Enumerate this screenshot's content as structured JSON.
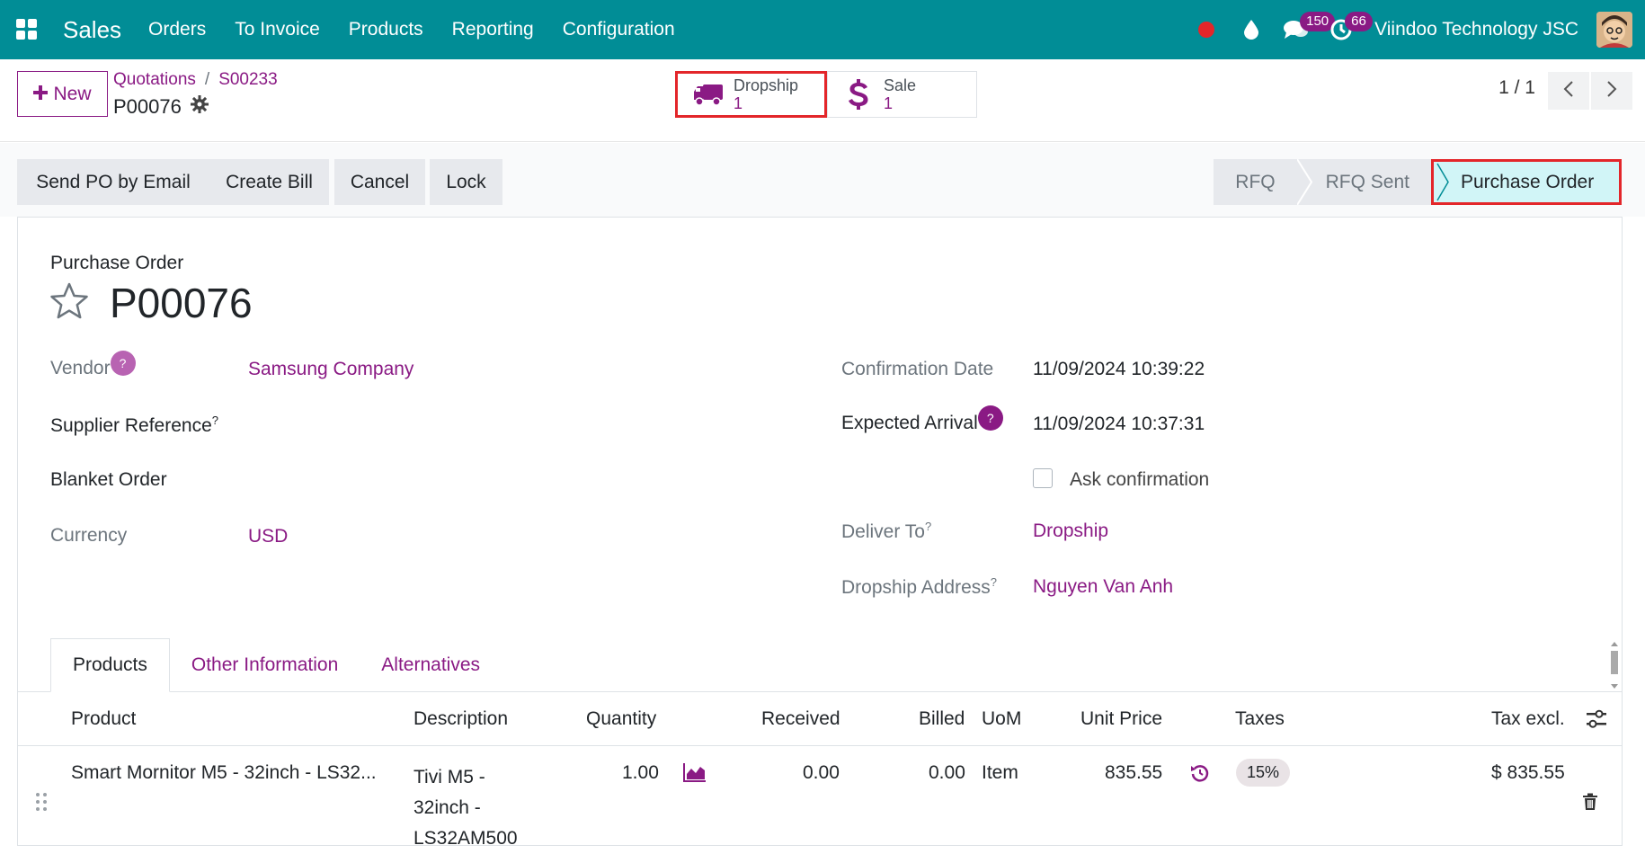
{
  "navbar": {
    "app_name": "Sales",
    "menu": [
      "Orders",
      "To Invoice",
      "Products",
      "Reporting",
      "Configuration"
    ],
    "messages_badge": "150",
    "activities_badge": "66",
    "company": "Viindoo Technology JSC"
  },
  "control": {
    "new_label": "New",
    "breadcrumb": [
      "Quotations",
      "S00233"
    ],
    "breadcrumb_sep": "/",
    "current_record": "P00076",
    "smart_buttons": [
      {
        "label": "Dropship",
        "value": "1",
        "icon": "truck-icon"
      },
      {
        "label": "Sale",
        "value": "1",
        "icon": "dollar-icon"
      }
    ],
    "pager": "1 / 1"
  },
  "actions": {
    "send_email": "Send PO by Email",
    "create_bill": "Create Bill",
    "cancel": "Cancel",
    "lock": "Lock"
  },
  "statusbar": {
    "stages": [
      "RFQ",
      "RFQ Sent",
      "Purchase Order"
    ],
    "active": "Purchase Order"
  },
  "form": {
    "subtitle": "Purchase Order",
    "title": "P00076",
    "vendor_label": "Vendor",
    "vendor_value": "Samsung Company",
    "supplier_ref_label": "Supplier Reference",
    "blanket_order_label": "Blanket Order",
    "currency_label": "Currency",
    "currency_value": "USD",
    "confirmation_date_label": "Confirmation Date",
    "confirmation_date_value": "11/09/2024 10:39:22",
    "expected_arrival_label": "Expected Arrival",
    "expected_arrival_value": "11/09/2024 10:37:31",
    "ask_confirmation_label": "Ask confirmation",
    "deliver_to_label": "Deliver To",
    "deliver_to_value": "Dropship",
    "dropship_address_label": "Dropship Address",
    "dropship_address_value": "Nguyen Van Anh",
    "help_mark": "?"
  },
  "tabs": [
    "Products",
    "Other Information",
    "Alternatives"
  ],
  "table": {
    "headers": [
      "Product",
      "Description",
      "Quantity",
      "Received",
      "Billed",
      "UoM",
      "Unit Price",
      "Taxes",
      "Tax excl."
    ],
    "row": {
      "product": "Smart Mornitor M5 - 32inch - LS32...",
      "description_lines": [
        "Tivi M5 -",
        "32inch -",
        "LS32AM500"
      ],
      "quantity": "1.00",
      "received": "0.00",
      "billed": "0.00",
      "uom": "Item",
      "unit_price": "835.55",
      "tax": "15%",
      "tax_excl": "$ 835.55"
    }
  },
  "colors": {
    "navbar": "#018d96",
    "accent": "#8a1a84",
    "highlight": "#e3262a",
    "active_stage": "#d1f5f7"
  }
}
